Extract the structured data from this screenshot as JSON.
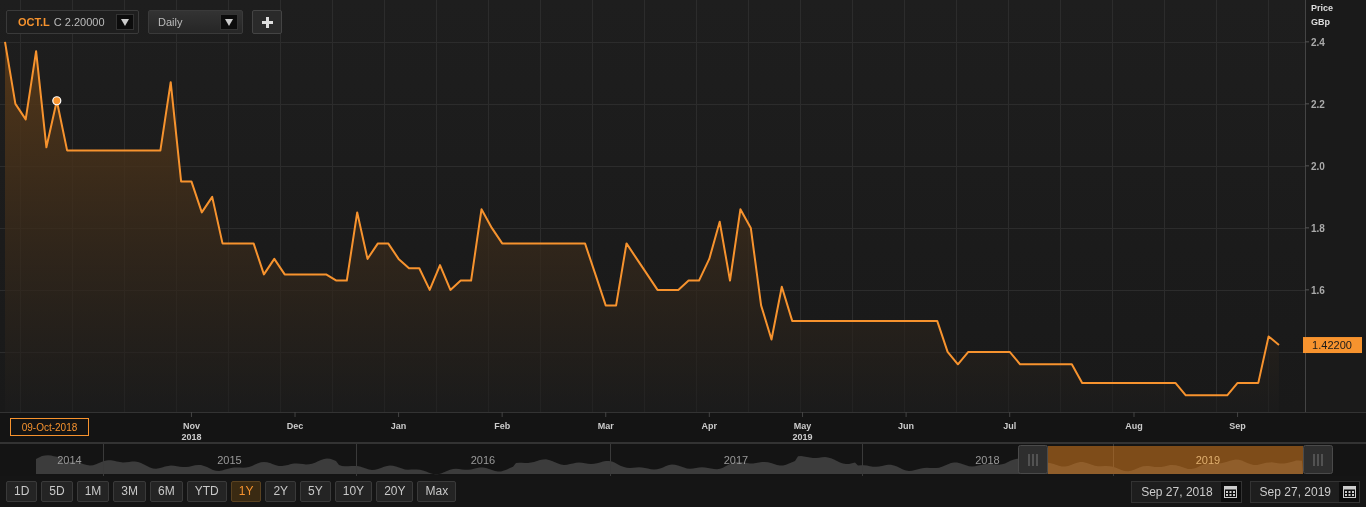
{
  "instrument": {
    "symbol": "OCT.L",
    "quote": "C 2.20000"
  },
  "interval": {
    "value": "Daily"
  },
  "price_axis": {
    "title": "Price",
    "unit": "GBp"
  },
  "last_price": "1.42200",
  "cursor": {
    "date": "09-Oct-2018"
  },
  "chart_data": {
    "type": "area",
    "grid": true,
    "ylim": [
      1.206,
      2.535
    ],
    "categories": [
      null,
      null,
      null,
      null,
      null,
      null,
      null,
      null,
      null,
      null,
      null,
      null,
      null,
      null,
      null,
      null,
      null,
      null,
      "Nov",
      null,
      null,
      null,
      null,
      null,
      null,
      null,
      null,
      null,
      "Dec",
      null,
      null,
      null,
      null,
      null,
      null,
      null,
      null,
      null,
      "Jan",
      null,
      null,
      null,
      null,
      null,
      null,
      null,
      null,
      null,
      "Feb",
      null,
      null,
      null,
      null,
      null,
      null,
      null,
      null,
      null,
      "Mar",
      null,
      null,
      null,
      null,
      null,
      null,
      null,
      null,
      null,
      "Apr",
      null,
      null,
      null,
      null,
      null,
      null,
      null,
      null,
      "May",
      null,
      null,
      null,
      null,
      null,
      null,
      null,
      null,
      null,
      "Jun",
      null,
      null,
      null,
      null,
      null,
      null,
      null,
      null,
      null,
      "Jul",
      null,
      null,
      null,
      null,
      null,
      null,
      null,
      null,
      null,
      null,
      null,
      "Aug",
      null,
      null,
      null,
      null,
      null,
      null,
      null,
      null,
      null,
      "Sep",
      null,
      null,
      null,
      null
    ],
    "yticks": [
      {
        "value": 1.6,
        "label": "1.6"
      },
      {
        "value": 1.8,
        "label": "1.8"
      },
      {
        "value": 2.0,
        "label": "2.0"
      },
      {
        "value": 2.2,
        "label": "2.2"
      },
      {
        "value": 2.4,
        "label": "2.4"
      }
    ],
    "series": [
      {
        "color": "#f7932e",
        "values": [
          2.4,
          2.2,
          2.15,
          2.37,
          2.06,
          2.21,
          2.05,
          2.05,
          2.05,
          2.05,
          2.05,
          2.05,
          2.05,
          2.05,
          2.05,
          2.05,
          2.27,
          1.95,
          1.95,
          1.85,
          1.9,
          1.75,
          1.75,
          1.75,
          1.75,
          1.65,
          1.7,
          1.65,
          1.65,
          1.65,
          1.65,
          1.65,
          1.63,
          1.63,
          1.85,
          1.7,
          1.75,
          1.75,
          1.7,
          1.67,
          1.67,
          1.6,
          1.68,
          1.6,
          1.63,
          1.63,
          1.86,
          1.8,
          1.75,
          1.75,
          1.75,
          1.75,
          1.75,
          1.75,
          1.75,
          1.75,
          1.75,
          1.65,
          1.55,
          1.55,
          1.75,
          1.7,
          1.65,
          1.6,
          1.6,
          1.6,
          1.63,
          1.63,
          1.7,
          1.82,
          1.63,
          1.86,
          1.8,
          1.55,
          1.44,
          1.61,
          1.5,
          1.5,
          1.5,
          1.5,
          1.5,
          1.5,
          1.5,
          1.5,
          1.5,
          1.5,
          1.5,
          1.5,
          1.5,
          1.5,
          1.5,
          1.4,
          1.36,
          1.4,
          1.4,
          1.4,
          1.4,
          1.4,
          1.36,
          1.36,
          1.36,
          1.36,
          1.36,
          1.36,
          1.3,
          1.3,
          1.3,
          1.3,
          1.3,
          1.3,
          1.3,
          1.3,
          1.3,
          1.3,
          1.26,
          1.26,
          1.26,
          1.26,
          1.26,
          1.3,
          1.3,
          1.3,
          1.45,
          1.422
        ]
      }
    ]
  },
  "year_marks": [
    "2018",
    "2019"
  ],
  "navigator": {
    "years": [
      "2014",
      "2015",
      "2016",
      "2017",
      "2018",
      "2019"
    ]
  },
  "periods": [
    {
      "label": "1D",
      "selected": false
    },
    {
      "label": "5D",
      "selected": false
    },
    {
      "label": "1M",
      "selected": false
    },
    {
      "label": "3M",
      "selected": false
    },
    {
      "label": "6M",
      "selected": false
    },
    {
      "label": "YTD",
      "selected": false
    },
    {
      "label": "1Y",
      "selected": true
    },
    {
      "label": "2Y",
      "selected": false
    },
    {
      "label": "5Y",
      "selected": false
    },
    {
      "label": "10Y",
      "selected": false
    },
    {
      "label": "20Y",
      "selected": false
    },
    {
      "label": "Max",
      "selected": false
    }
  ],
  "date_range": {
    "from": "Sep 27, 2018",
    "to": "Sep 27, 2019"
  }
}
